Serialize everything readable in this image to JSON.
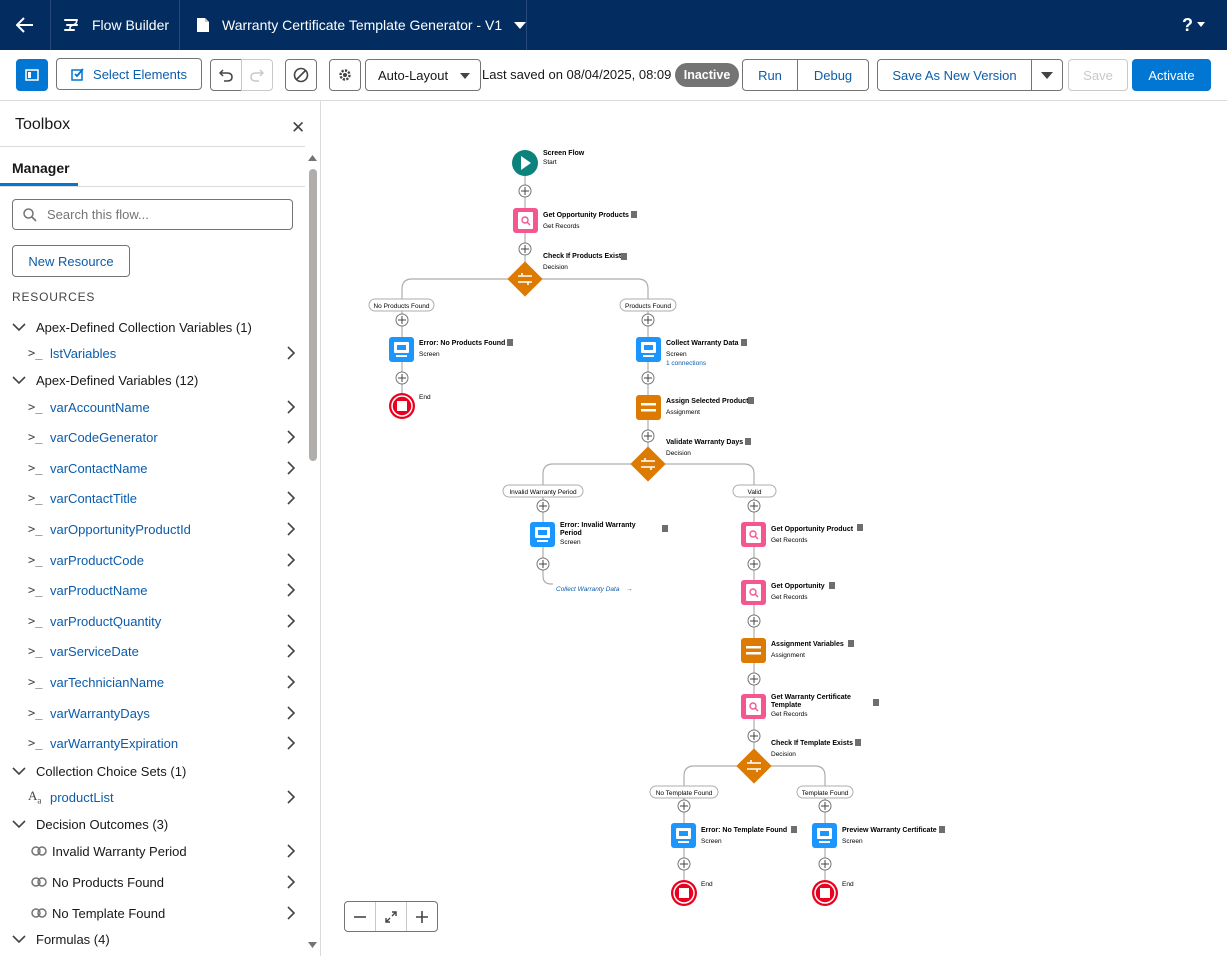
{
  "header": {
    "app_name": "Flow Builder",
    "flow_title": "Warranty Certificate Template Generator - V1",
    "help_label": "?"
  },
  "toolbar": {
    "select_elements": "Select Elements",
    "layout_mode": "Auto-Layout",
    "last_saved": "Last saved on 08/04/2025, 08:09",
    "status": "Inactive",
    "run": "Run",
    "debug": "Debug",
    "save_as_new": "Save As New Version",
    "save": "Save",
    "activate": "Activate"
  },
  "toolbox": {
    "title": "Toolbox",
    "tab": "Manager",
    "search_placeholder": "Search this flow...",
    "new_resource": "New Resource",
    "resources_heading": "RESOURCES",
    "sections": [
      {
        "label": "Apex-Defined Collection Variables (1)",
        "items": [
          "lstVariables"
        ]
      },
      {
        "label": "Apex-Defined Variables (12)",
        "items": [
          "varAccountName",
          "varCodeGenerator",
          "varContactName",
          "varContactTitle",
          "varOpportunityProductId",
          "varProductCode",
          "varProductName",
          "varProductQuantity",
          "varServiceDate",
          "varTechnicianName",
          "varWarrantyDays",
          "varWarrantyExpiration"
        ]
      },
      {
        "label": "Collection Choice Sets (1)",
        "items": [
          "productList"
        ]
      },
      {
        "label": "Decision Outcomes (3)",
        "items": [
          "Invalid Warranty Period",
          "No Products Found",
          "No Template Found"
        ]
      },
      {
        "label": "Formulas (4)",
        "items": []
      }
    ]
  },
  "flow": {
    "start": {
      "title": "Screen Flow",
      "sub": "Start"
    },
    "get_opp_products": {
      "title": "Get Opportunity Products",
      "sub": "Get Records"
    },
    "check_products": {
      "title": "Check If Products Exist",
      "sub": "Decision"
    },
    "branch_no_products": "No Products Found",
    "branch_products_found": "Products Found",
    "err_no_products": {
      "title": "Error: No Products Found",
      "sub": "Screen"
    },
    "end_label": "End",
    "collect_warranty": {
      "title": "Collect Warranty Data",
      "sub": "Screen",
      "note": "1 connections"
    },
    "assign_selected": {
      "title": "Assign Selected Product",
      "sub": "Assignment"
    },
    "validate_days": {
      "title": "Validate Warranty Days",
      "sub": "Decision"
    },
    "branch_invalid": "Invalid Warranty Period",
    "branch_valid": "Valid",
    "err_invalid": {
      "title1": "Error: Invalid Warranty",
      "title2": "Period",
      "sub": "Screen"
    },
    "goto_collect": "Collect Warranty Data",
    "get_opp_product": {
      "title": "Get Opportunity Product",
      "sub": "Get Records"
    },
    "get_opp": {
      "title": "Get Opportunity",
      "sub": "Get Records"
    },
    "assign_vars": {
      "title": "Assignment Variables",
      "sub": "Assignment"
    },
    "get_template": {
      "title1": "Get Warranty Certificate",
      "title2": "Template",
      "sub": "Get Records"
    },
    "check_template": {
      "title": "Check If Template Exists",
      "sub": "Decision"
    },
    "branch_no_template": "No Template Found",
    "branch_template_found": "Template Found",
    "err_no_template": {
      "title": "Error: No Template Found",
      "sub": "Screen"
    },
    "preview_cert": {
      "title": "Preview Warranty Certificate",
      "sub": "Screen"
    }
  },
  "colors": {
    "header_bg": "#032d60",
    "brand_blue": "#0176d3",
    "get_records": "#f4578f",
    "decision": "#dd7a01",
    "assignment": "#dd7a01",
    "screen": "#1b96ff",
    "start": "#0b827c",
    "end": "#ea001e"
  }
}
